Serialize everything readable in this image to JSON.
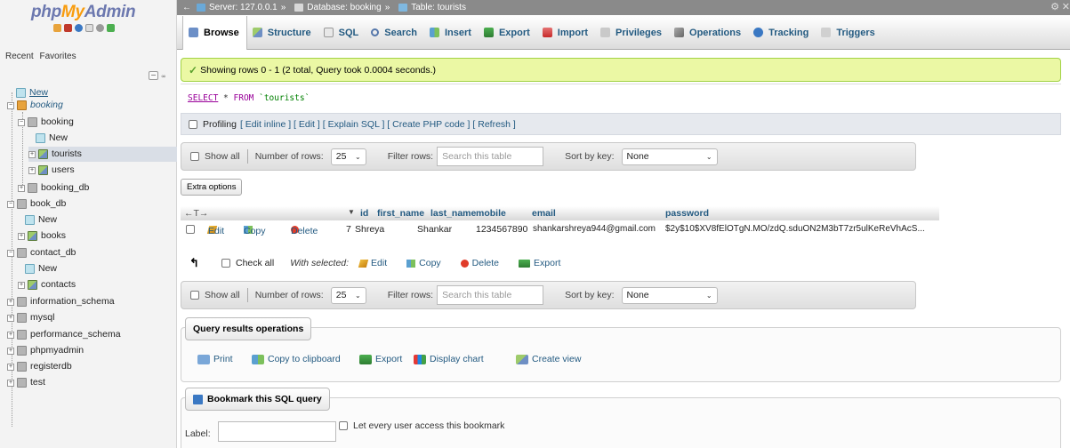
{
  "nav": {
    "logo": {
      "php": "php",
      "my": "My",
      "admin": "Admin"
    },
    "tab_recent": "Recent",
    "tab_favorites": "Favorites",
    "tree": {
      "new_root": "New",
      "booking_root": "booking",
      "booking": "booking",
      "booking_new": "New",
      "tourists": "tourists",
      "users": "users",
      "booking_db": "booking_db",
      "book_db": "book_db",
      "book_db_new": "New",
      "books": "books",
      "contact_db": "contact_db",
      "contact_db_new": "New",
      "contacts": "contacts",
      "information_schema": "information_schema",
      "mysql": "mysql",
      "performance_schema": "performance_schema",
      "phpmyadmin": "phpmyadmin",
      "registerdb": "registerdb",
      "test": "test"
    }
  },
  "breadcrumb": {
    "server": "Server: 127.0.0.1",
    "database": "Database: booking",
    "table": "Table: tourists",
    "sep": "»"
  },
  "menu": {
    "browse": "Browse",
    "structure": "Structure",
    "sql": "SQL",
    "search": "Search",
    "insert": "Insert",
    "export": "Export",
    "import": "Import",
    "privileges": "Privileges",
    "operations": "Operations",
    "tracking": "Tracking",
    "triggers": "Triggers"
  },
  "message": {
    "success": "Showing rows 0 - 1 (2 total, Query took 0.0004 seconds.)"
  },
  "sql": {
    "select": "SELECT",
    "star": " * ",
    "from": "FROM",
    "table": " `tourists`"
  },
  "profiling": {
    "label": "Profiling",
    "links": "[ Edit inline ] [ Edit ] [ Explain SQL ] [ Create PHP code ] [ Refresh ]"
  },
  "navbar": {
    "show_all": "Show all",
    "number_of_rows": "Number of rows:",
    "rows_value": "25",
    "filter_rows": "Filter rows:",
    "filter_placeholder": "Search this table",
    "sort_by_key": "Sort by key:",
    "sort_value": "None"
  },
  "extra_options": "Extra options",
  "table": {
    "nav_arrows": "←T→",
    "sort_indicator": "▼",
    "columns": [
      "id",
      "first_name",
      "last_name",
      "mobile",
      "email",
      "password"
    ],
    "row": {
      "edit": "Edit",
      "copy": "Copy",
      "delete": "Delete",
      "id": "7",
      "first_name": "Shreya",
      "last_name": "Shankar",
      "mobile": "1234567890",
      "email": "shankarshreya944@gmail.com",
      "password": "$2y$10$XV8fElOTgN.MO/zdQ.sduON2M3bT7zr5ulKeReVhAcS..."
    }
  },
  "bulk": {
    "check_all": "Check all",
    "with_selected": "With selected:",
    "edit": "Edit",
    "copy": "Copy",
    "delete": "Delete",
    "export": "Export"
  },
  "query_ops": {
    "title": "Query results operations",
    "print": "Print",
    "copy_clipboard": "Copy to clipboard",
    "export": "Export",
    "display_chart": "Display chart",
    "create_view": "Create view"
  },
  "bookmark": {
    "title": "Bookmark this SQL query",
    "label": "Label:",
    "every_user": "Let every user access this bookmark"
  }
}
